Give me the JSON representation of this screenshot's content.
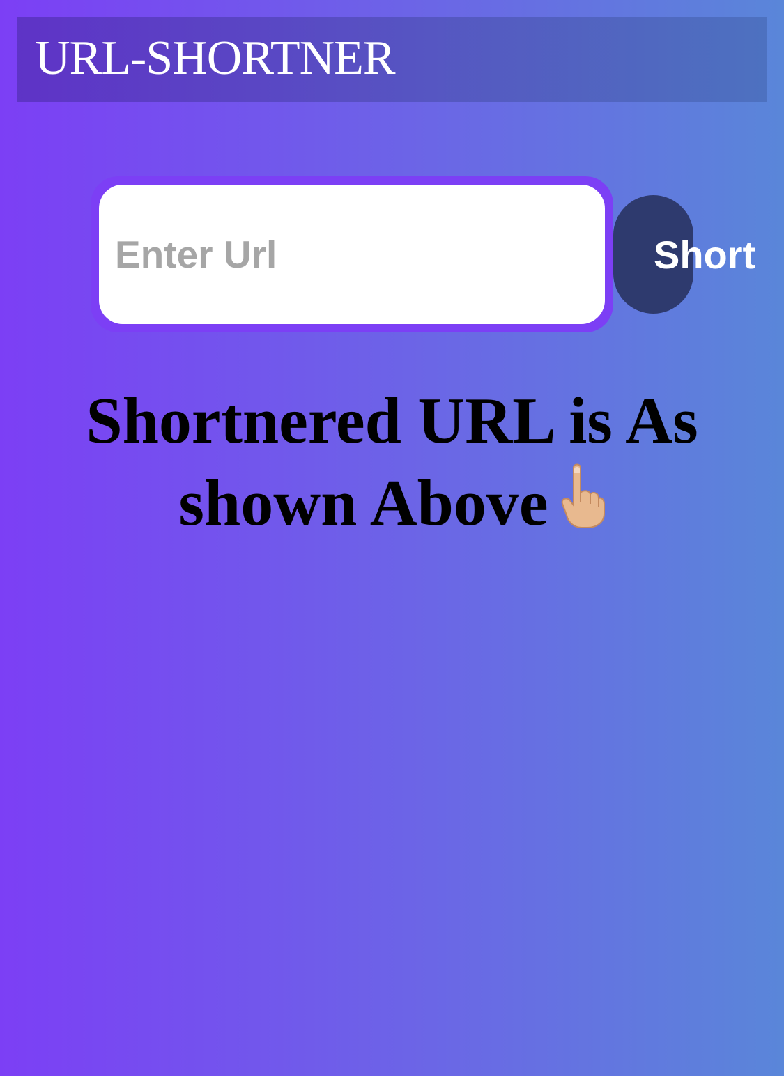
{
  "header": {
    "title": "URL-SHORTNER"
  },
  "form": {
    "url_placeholder": "Enter Url",
    "url_value": "",
    "short_button_label": "Short"
  },
  "result": {
    "message": "Shortnered URL is As shown Above",
    "emoji_icon": "pointing-up-hand-icon"
  },
  "colors": {
    "background_start": "#7c3ff5",
    "background_end": "#5a86d9",
    "input_border": "#7c3ff5",
    "button_background": "#2e3a6e",
    "header_text": "#ffffff"
  }
}
